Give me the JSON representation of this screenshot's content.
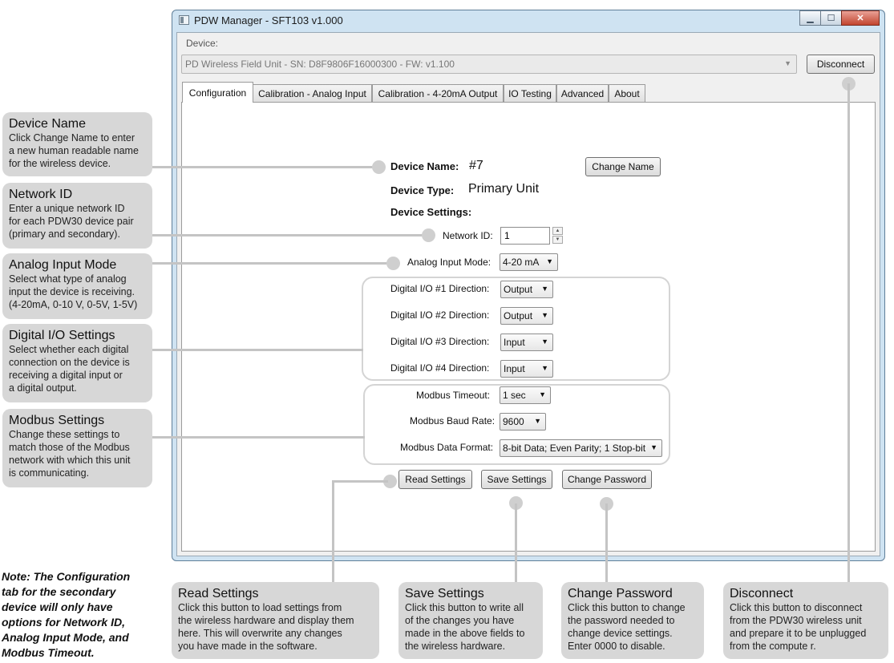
{
  "window": {
    "title": "PDW Manager - SFT103 v1.000",
    "controls": {
      "minimize": "▁",
      "maximize": "☐",
      "close": "✕"
    }
  },
  "device": {
    "label": "Device:",
    "selected": "PD Wireless Field Unit - SN: D8F9806F16000300 - FW: v1.100",
    "disconnect_label": "Disconnect"
  },
  "tabs": [
    {
      "label": "Configuration",
      "active": true
    },
    {
      "label": "Calibration - Analog Input"
    },
    {
      "label": "Calibration - 4-20mA Output"
    },
    {
      "label": "IO Testing"
    },
    {
      "label": "Advanced"
    },
    {
      "label": "About"
    }
  ],
  "config": {
    "device_name_label": "Device Name:",
    "device_name_value": "#7",
    "change_name_label": "Change Name",
    "device_type_label": "Device Type:",
    "device_type_value": "Primary Unit",
    "device_settings_label": "Device Settings:",
    "network_id_label": "Network ID:",
    "network_id_value": "1",
    "analog_mode_label": "Analog Input Mode:",
    "analog_mode_value": "4-20 mA",
    "dio": [
      {
        "label": "Digital I/O #1  Direction:",
        "value": "Output"
      },
      {
        "label": "Digital I/O #2  Direction:",
        "value": "Output"
      },
      {
        "label": "Digital I/O #3  Direction:",
        "value": "Input"
      },
      {
        "label": "Digital I/O #4  Direction:",
        "value": "Input"
      }
    ],
    "modbus_timeout_label": "Modbus Timeout:",
    "modbus_timeout_value": "1 sec",
    "modbus_baud_label": "Modbus Baud Rate:",
    "modbus_baud_value": "9600",
    "modbus_format_label": "Modbus Data Format:",
    "modbus_format_value": "8-bit Data; Even Parity; 1 Stop-bit",
    "read_label": "Read Settings",
    "save_label": "Save Settings",
    "change_password_label": "Change Password"
  },
  "callouts": {
    "device_name": {
      "title": "Device Name",
      "text": "Click Change Name to enter\na new human readable name\nfor the wireless device."
    },
    "network_id": {
      "title": "Network ID",
      "text": "Enter a unique network ID\nfor each PDW30 device pair\n(primary and secondary)."
    },
    "analog_input": {
      "title": "Analog Input Mode",
      "text": "Select what type of analog\ninput the device is receiving.\n(4-20mA, 0-10 V, 0-5V, 1-5V)"
    },
    "digital_io": {
      "title": "Digital I/O Settings",
      "text": "Select whether each digital\nconnection on the device is\nreceiving a digital input or\na digital output."
    },
    "modbus": {
      "title": "Modbus Settings",
      "text": "Change these settings to\nmatch those of the Modbus\nnetwork with which this unit\nis communicating."
    },
    "read_settings": {
      "title": "Read Settings",
      "text": "Click this button to load settings from\nthe wireless hardware and display them\nhere. This will overwrite any changes\nyou have made in the software."
    },
    "save_settings": {
      "title": "Save Settings",
      "text": "Click this button to write all\nof the changes you have\nmade in the above fields to\nthe wireless hardware."
    },
    "change_password": {
      "title": "Change Password",
      "text": "Click this button to change\nthe password needed to\nchange device settings.\nEnter 0000 to disable."
    },
    "disconnect": {
      "title": "Disconnect",
      "text": "Click this button to disconnect\nfrom the PDW30 wireless unit\nand prepare it to be unplugged\nfrom the compute r."
    }
  },
  "note": "Note: The Configuration\ntab for the secondary\ndevice will only have\noptions for Network ID,\nAnalog Input Mode, and\nModbus Timeout."
}
